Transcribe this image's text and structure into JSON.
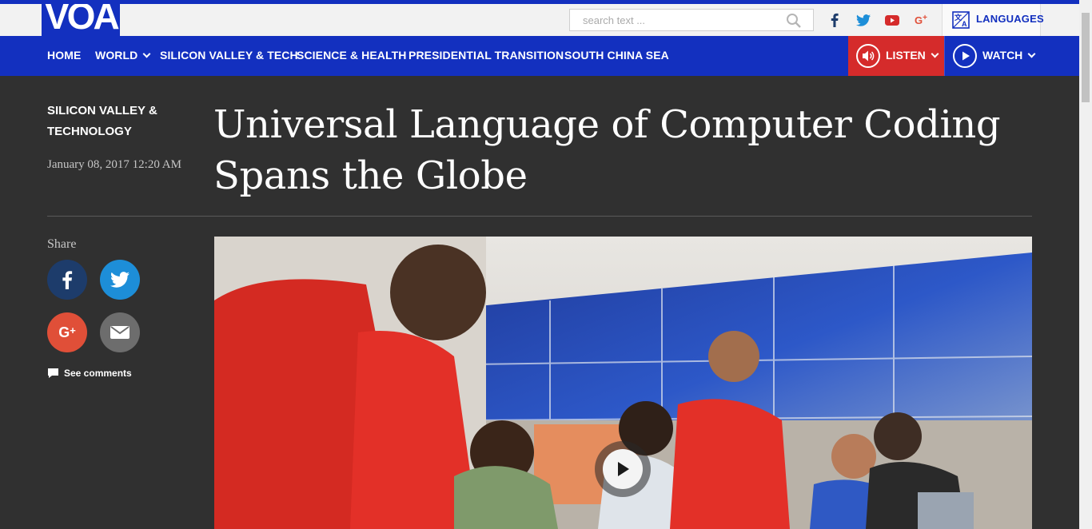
{
  "brand": {
    "logo_text": "VOA"
  },
  "search": {
    "placeholder": "search text ..."
  },
  "social": {
    "facebook_color": "#1d3c6b",
    "twitter_color": "#1da1f2",
    "youtube_color": "#d52b2b",
    "gplus_color": "#e04f38"
  },
  "languages": {
    "label": "LANGUAGES"
  },
  "nav": {
    "items": [
      "HOME",
      "WORLD",
      "SILICON VALLEY & TECH",
      "SCIENCE & HEALTH",
      "PRESIDENTIAL TRANSITION",
      "SOUTH CHINA SEA"
    ],
    "listen_label": "LISTEN",
    "watch_label": "WATCH"
  },
  "article": {
    "kicker": "SILICON VALLEY & TECHNOLOGY",
    "date": "January 08, 2017 12:20 AM",
    "headline": "Universal Language of Computer Coding Spans the Globe"
  },
  "share": {
    "label": "Share",
    "comments_label": "See comments"
  },
  "colors": {
    "brand_blue": "#1330bf",
    "listen_red": "#d52b2b",
    "page_bg": "#303030"
  },
  "icons": [
    "search-icon",
    "facebook-icon",
    "twitter-icon",
    "youtube-icon",
    "google-plus-icon",
    "languages-icon",
    "speaker-icon",
    "play-icon",
    "email-icon",
    "comment-icon"
  ]
}
